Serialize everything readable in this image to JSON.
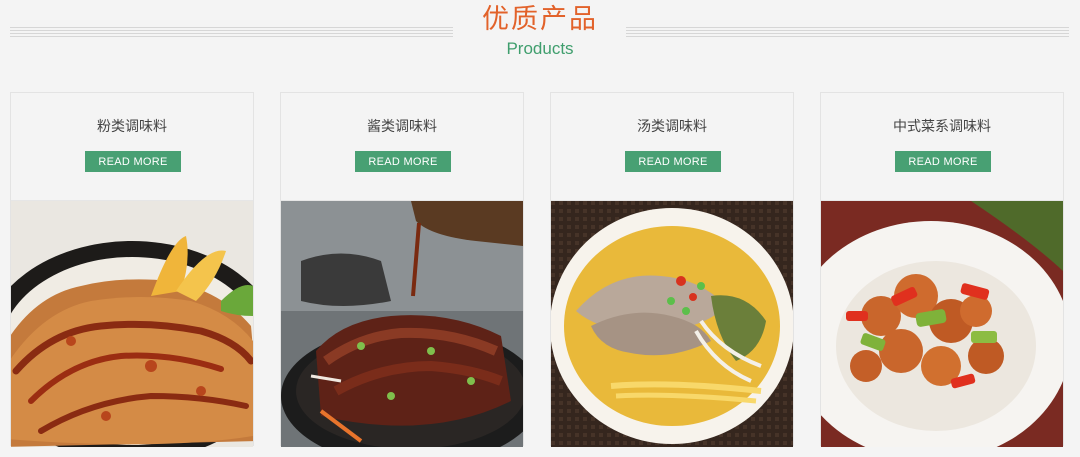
{
  "header": {
    "title_cn": "优质产品",
    "title_en": "Products"
  },
  "colors": {
    "title_accent": "#e2622a",
    "green_accent": "#3f9e6d",
    "button_bg": "#48a073"
  },
  "products": [
    {
      "name": "粉类调味料",
      "button_label": "READ MORE",
      "image": "fried-chicken-cutlet-with-sauce"
    },
    {
      "name": "酱类调味料",
      "button_label": "READ MORE",
      "image": "sizzling-beef-with-sauce-pour"
    },
    {
      "name": "汤类调味料",
      "button_label": "READ MORE",
      "image": "noodle-soup-with-beef"
    },
    {
      "name": "中式菜系调味料",
      "button_label": "READ MORE",
      "image": "sweet-and-sour-pork"
    }
  ]
}
